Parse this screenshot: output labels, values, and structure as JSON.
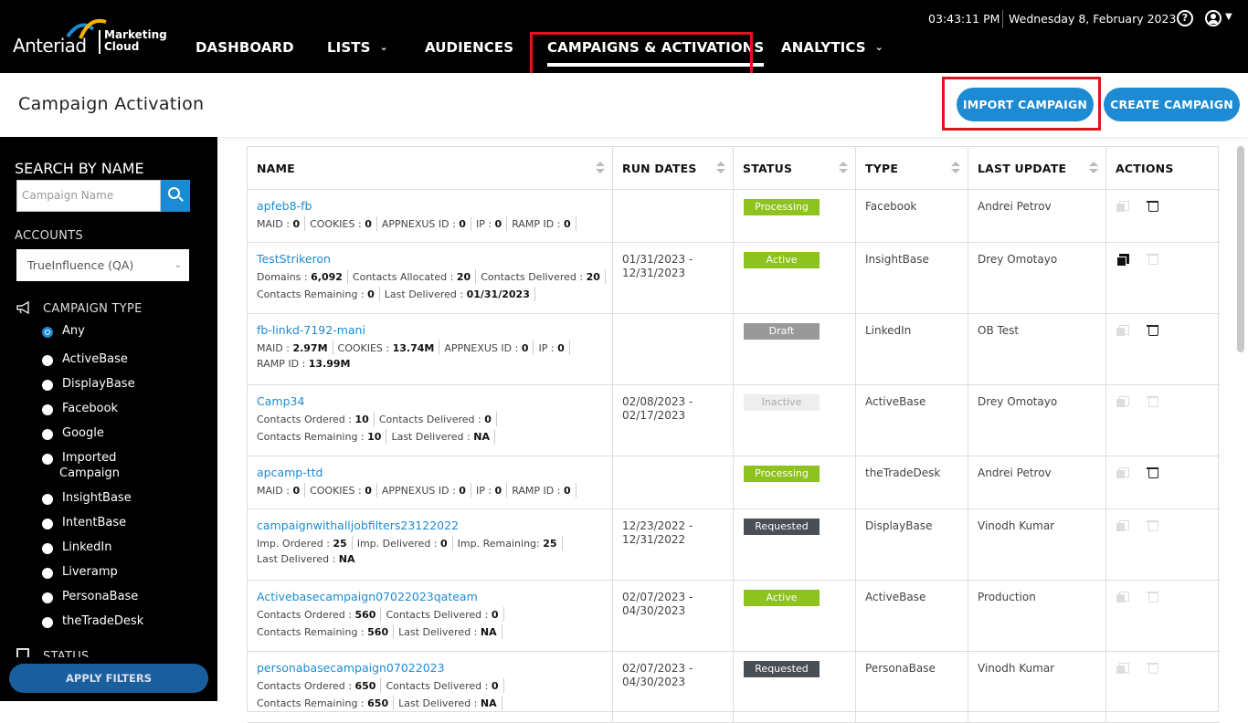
{
  "topbar": {
    "brand": "Anteriad",
    "brand_sub_1": "Marketing",
    "brand_sub_2": "Cloud",
    "time": "03:43:11 PM",
    "date": "Wednesday 8, February 2023",
    "help_icon": "?"
  },
  "nav": {
    "items": [
      {
        "label": "DASHBOARD"
      },
      {
        "label": "LISTS"
      },
      {
        "label": "AUDIENCES"
      },
      {
        "label": "CAMPAIGNS & ACTIVATIONS"
      },
      {
        "label": "ANALYTICS"
      }
    ]
  },
  "header": {
    "title": "Campaign Activation",
    "import_button": "IMPORT CAMPAIGN",
    "create_button": "CREATE CAMPAIGN"
  },
  "sidebar": {
    "search_label": "SEARCH BY NAME",
    "search_placeholder": "Campaign Name",
    "accounts_label": "ACCOUNTS",
    "account_value": "TrueInfluence (QA)",
    "campaign_type_label": "CAMPAIGN TYPE",
    "types": [
      "Any",
      "ActiveBase",
      "DisplayBase",
      "Facebook",
      "Google",
      "Imported",
      "Campaign",
      "InsightBase",
      "IntentBase",
      "LinkedIn",
      "Liveramp",
      "PersonaBase",
      "theTradeDesk"
    ],
    "selected_type": "Any",
    "status_label": "STATUS",
    "apply_button": "APPLY FILTERS"
  },
  "table": {
    "columns": [
      "NAME",
      "RUN DATES",
      "STATUS",
      "TYPE",
      "LAST UPDATE",
      "ACTIONS"
    ],
    "rows": [
      {
        "name": "apfeb8-fb",
        "line1": [
          [
            "MAID : ",
            "0"
          ],
          [
            "COOKIES : ",
            "0"
          ],
          [
            "APPNEXUS ID : ",
            "0"
          ],
          [
            "IP : ",
            "0"
          ],
          [
            "RAMP ID : ",
            "0"
          ]
        ],
        "line2": [],
        "line3": [],
        "dates1": "",
        "dates2": "",
        "status": "Processing",
        "type": "Facebook",
        "updated_by": "Andrei Petrov",
        "copy_active": false,
        "delete_active": true
      },
      {
        "name": "TestStrikeron",
        "line1": [
          [
            "Domains : ",
            "6,092"
          ],
          [
            "Contacts Allocated : ",
            "20"
          ],
          [
            "Contacts Delivered : ",
            "20"
          ]
        ],
        "line2": [
          [
            "Contacts Remaining : ",
            "0"
          ],
          [
            "Last Delivered : ",
            "01/31/2023"
          ]
        ],
        "line3": [],
        "dates1": "01/31/2023 -",
        "dates2": "12/31/2023",
        "status": "Active",
        "type": "InsightBase",
        "updated_by": "Drey Omotayo",
        "copy_active": true,
        "delete_active": false
      },
      {
        "name": "fb-linkd-7192-mani",
        "line1": [
          [
            "MAID : ",
            "2.97M"
          ],
          [
            "COOKIES : ",
            "13.74M"
          ],
          [
            "APPNEXUS ID : ",
            "0"
          ],
          [
            "IP : ",
            "0"
          ]
        ],
        "line2": [
          [
            "RAMP ID : ",
            "13.99M"
          ]
        ],
        "line3": [],
        "dates1": "",
        "dates2": "",
        "status": "Draft",
        "type": "LinkedIn",
        "updated_by": "OB Test",
        "copy_active": false,
        "delete_active": true
      },
      {
        "name": "Camp34",
        "line1": [
          [
            "Contacts Ordered : ",
            "10"
          ],
          [
            "Contacts Delivered : ",
            "0"
          ]
        ],
        "line2": [
          [
            "Contacts Remaining : ",
            "10"
          ],
          [
            "Last Delivered : ",
            "NA"
          ]
        ],
        "line3": [],
        "dates1": "02/08/2023 -",
        "dates2": "02/17/2023",
        "status": "Inactive",
        "type": "ActiveBase",
        "updated_by": "Drey Omotayo",
        "copy_active": false,
        "delete_active": false
      },
      {
        "name": "apcamp-ttd",
        "line1": [
          [
            "MAID : ",
            "0"
          ],
          [
            "COOKIES : ",
            "0"
          ],
          [
            "APPNEXUS ID : ",
            "0"
          ],
          [
            "IP : ",
            "0"
          ],
          [
            "RAMP ID : ",
            "0"
          ]
        ],
        "line2": [],
        "line3": [],
        "dates1": "",
        "dates2": "",
        "status": "Processing",
        "type": "theTradeDesk",
        "updated_by": "Andrei Petrov",
        "copy_active": false,
        "delete_active": true
      },
      {
        "name": "campaignwithalljobfilters23122022",
        "line1": [
          [
            "Imp. Ordered : ",
            "25"
          ],
          [
            "Imp. Delivered : ",
            "0"
          ],
          [
            "Imp. Remaining: ",
            "25"
          ]
        ],
        "line2": [
          [
            "Last Delivered : ",
            "NA"
          ]
        ],
        "line3": [],
        "dates1": "12/23/2022 -",
        "dates2": "12/31/2022",
        "status": "Requested",
        "type": "DisplayBase",
        "updated_by": "Vinodh Kumar",
        "copy_active": false,
        "delete_active": false
      },
      {
        "name": "Activebasecampaign07022023qateam",
        "line1": [
          [
            "Contacts Ordered : ",
            "560"
          ],
          [
            "Contacts Delivered : ",
            "0"
          ]
        ],
        "line2": [
          [
            "Contacts Remaining : ",
            "560"
          ],
          [
            "Last Delivered : ",
            "NA"
          ]
        ],
        "line3": [],
        "dates1": "02/07/2023 -",
        "dates2": "04/30/2023",
        "status": "Active",
        "type": "ActiveBase",
        "updated_by": "Production",
        "copy_active": false,
        "delete_active": false
      },
      {
        "name": "personabasecampaign07022023",
        "line1": [
          [
            "Contacts Ordered : ",
            "650"
          ],
          [
            "Contacts Delivered : ",
            "0"
          ]
        ],
        "line2": [
          [
            "Contacts Remaining : ",
            "650"
          ],
          [
            "Last Delivered : ",
            "NA"
          ]
        ],
        "line3": [],
        "dates1": "02/07/2023 -",
        "dates2": "04/30/2023",
        "status": "Requested",
        "type": "PersonaBase",
        "updated_by": "Vinodh Kumar",
        "copy_active": false,
        "delete_active": false
      }
    ]
  },
  "colors": {
    "accent": "#1c8bd3",
    "highlight_box": "#e0141e",
    "active": "#8dc21f",
    "requested": "#4a4f55"
  }
}
